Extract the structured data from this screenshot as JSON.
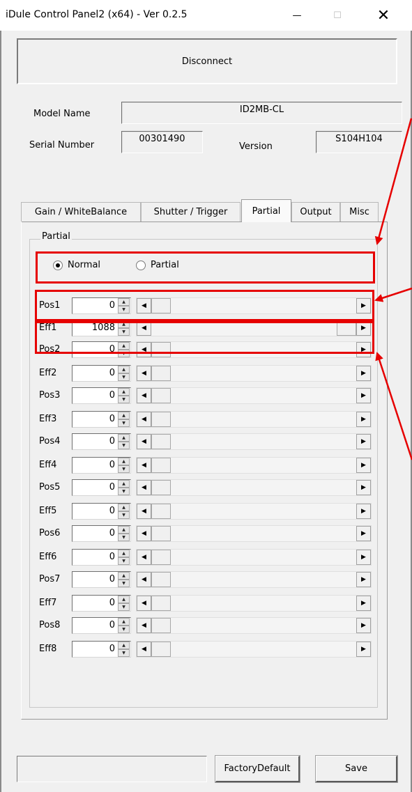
{
  "window": {
    "title": "iDule Control Panel2 (x64) - Ver 0.2.5",
    "minimize_glyph": "—",
    "maximize_glyph": "☐",
    "close_glyph": "✕"
  },
  "connection": {
    "button_label": "Disconnect"
  },
  "device": {
    "model_label": "Model Name",
    "model_value": "ID2MB-CL",
    "serial_label": "Serial Number",
    "serial_value": "00301490",
    "version_label": "Version",
    "version_value": "S104H104"
  },
  "tabs": [
    {
      "label": "Gain / WhiteBalance",
      "active": false
    },
    {
      "label": "Shutter / Trigger",
      "active": false
    },
    {
      "label": "Partial",
      "active": true
    },
    {
      "label": "Output",
      "active": false
    },
    {
      "label": "Misc",
      "active": false
    }
  ],
  "partial": {
    "group_label": "Partial",
    "mode_options": [
      {
        "label": "Normal",
        "checked": true
      },
      {
        "label": "Partial",
        "checked": false
      }
    ],
    "rows": [
      {
        "label": "Pos1",
        "value": "0",
        "thumb_fraction": 0.0
      },
      {
        "label": "Eff1",
        "value": "1088",
        "thumb_fraction": 1.0
      },
      {
        "label": "Pos2",
        "value": "0",
        "thumb_fraction": 0.0
      },
      {
        "label": "Eff2",
        "value": "0",
        "thumb_fraction": 0.0
      },
      {
        "label": "Pos3",
        "value": "0",
        "thumb_fraction": 0.0
      },
      {
        "label": "Eff3",
        "value": "0",
        "thumb_fraction": 0.0
      },
      {
        "label": "Pos4",
        "value": "0",
        "thumb_fraction": 0.0
      },
      {
        "label": "Eff4",
        "value": "0",
        "thumb_fraction": 0.0
      },
      {
        "label": "Pos5",
        "value": "0",
        "thumb_fraction": 0.0
      },
      {
        "label": "Eff5",
        "value": "0",
        "thumb_fraction": 0.0
      },
      {
        "label": "Pos6",
        "value": "0",
        "thumb_fraction": 0.0
      },
      {
        "label": "Eff6",
        "value": "0",
        "thumb_fraction": 0.0
      },
      {
        "label": "Pos7",
        "value": "0",
        "thumb_fraction": 0.0
      },
      {
        "label": "Eff7",
        "value": "0",
        "thumb_fraction": 0.0
      },
      {
        "label": "Pos8",
        "value": "0",
        "thumb_fraction": 0.0
      },
      {
        "label": "Eff8",
        "value": "0",
        "thumb_fraction": 0.0
      }
    ]
  },
  "footer": {
    "status_text": "",
    "factory_default_label": "FactoryDefault",
    "save_label": "Save"
  },
  "colors": {
    "annotation": "#e60000",
    "window_bg": "#f0f0f0"
  }
}
